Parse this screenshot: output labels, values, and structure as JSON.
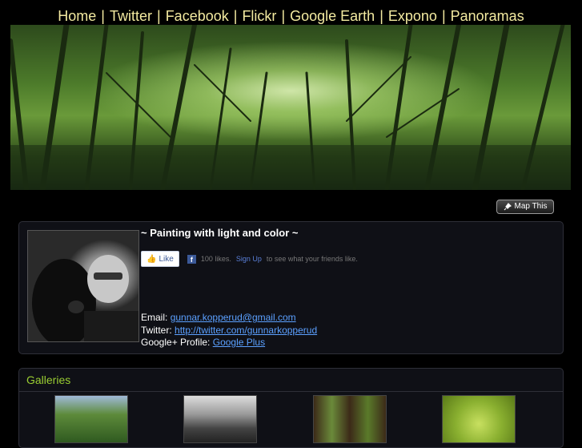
{
  "nav": {
    "items": [
      "Home",
      "Twitter",
      "Facebook",
      "Flickr",
      "Google Earth",
      "Expono",
      "Panoramas"
    ],
    "separator": "|"
  },
  "map_button": {
    "label": "Map This"
  },
  "bio": {
    "title": "~ Painting with light and color ~",
    "like_label": "Like",
    "likes_text": "100 likes.",
    "signup_label": "Sign Up",
    "signup_suffix": "to see what your friends like.",
    "email_label": "Email:",
    "email_value": "gunnar.kopperud@gmail.com",
    "twitter_label": "Twitter:",
    "twitter_value": "http://twitter.com/gunnarkopperud",
    "gplus_label": "Google+ Profile:",
    "gplus_value": "Google Plus"
  },
  "galleries": {
    "title": "Galleries"
  },
  "colors": {
    "nav_text": "#f3eaa0",
    "galleries_title": "#9acd32",
    "link": "#5ba0ff"
  }
}
